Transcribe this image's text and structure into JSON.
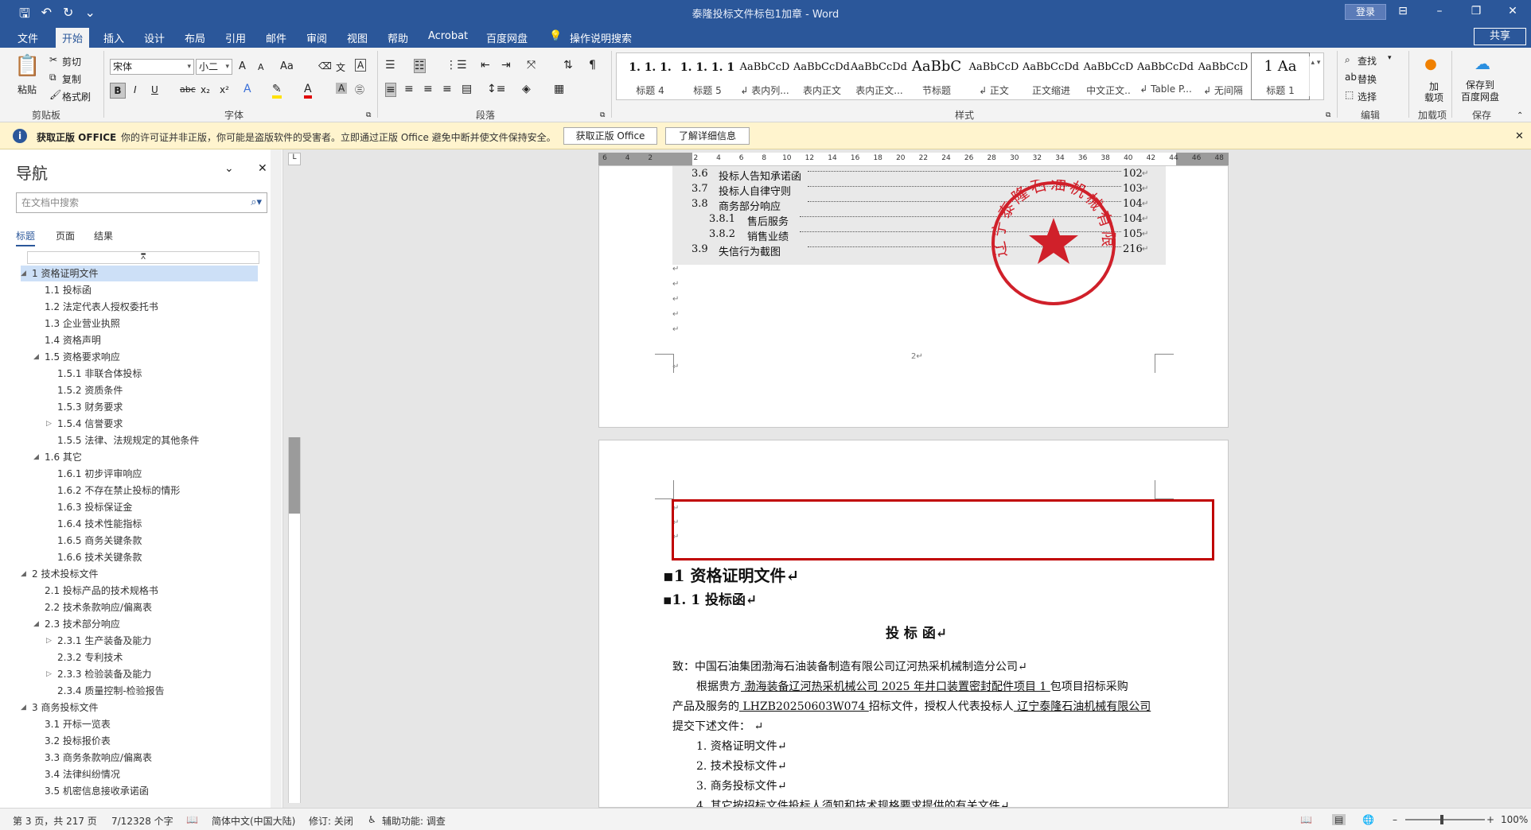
{
  "window": {
    "title": "泰隆投标文件标包1加章 - Word",
    "signin": "登录"
  },
  "qat": {
    "save": "🖫",
    "undo": "↶",
    "redo": "↻",
    "customize": "⌄"
  },
  "tabs": [
    {
      "label": "文件"
    },
    {
      "label": "开始"
    },
    {
      "label": "插入"
    },
    {
      "label": "设计"
    },
    {
      "label": "布局"
    },
    {
      "label": "引用"
    },
    {
      "label": "邮件"
    },
    {
      "label": "审阅"
    },
    {
      "label": "视图"
    },
    {
      "label": "帮助"
    },
    {
      "label": "Acrobat"
    },
    {
      "label": "百度网盘"
    },
    {
      "label": "操作说明搜索"
    }
  ],
  "share": "共享",
  "ribbon": {
    "clipboard": {
      "paste": "粘贴",
      "cut": "剪切",
      "copy": "复制",
      "format_painter": "格式刷",
      "group": "剪贴板"
    },
    "font": {
      "name": "宋体",
      "size": "小二",
      "group": "字体",
      "bold": "B",
      "italic": "I",
      "underline": "U",
      "strike": "abc",
      "sub": "x₂",
      "sup": "x²",
      "grow": "A",
      "shrink": "A",
      "case": "Aa"
    },
    "paragraph": {
      "group": "段落"
    },
    "styles": {
      "group": "样式",
      "items": [
        {
          "preview": "1. 1. 1.",
          "name": "标题 4"
        },
        {
          "preview": "1. 1. 1. 1",
          "name": "标题 5"
        },
        {
          "preview": "AaBbCcD",
          "name": "↲ 表内列..."
        },
        {
          "preview": "AaBbCcDdI",
          "name": "表内正文"
        },
        {
          "preview": "AaBbCcDdI",
          "name": "表内正文..."
        },
        {
          "preview": "AaBbC",
          "name": "节标题"
        },
        {
          "preview": "AaBbCcD",
          "name": "↲ 正文"
        },
        {
          "preview": "AaBbCcDdI",
          "name": "正文缩进"
        },
        {
          "preview": "AaBbCcD",
          "name": "中文正文.."
        },
        {
          "preview": "AaBbCcDdI",
          "name": "↲ Table P..."
        },
        {
          "preview": "AaBbCcD",
          "name": "↲ 无间隔"
        },
        {
          "preview": "1  Aa",
          "name": "标题 1"
        }
      ]
    },
    "editing": {
      "find": "查找",
      "replace": "替换",
      "select": "选择",
      "group": "编辑"
    },
    "addins": {
      "label": "加载项",
      "button": "加\n载项"
    },
    "save": {
      "label": "保存到\n百度网盘",
      "group": "保存"
    }
  },
  "message_bar": {
    "title": "获取正版 OFFICE",
    "text": "你的许可证并非正版，你可能是盗版软件的受害者。立即通过正版 Office 避免中断并使文件保持安全。",
    "btn1": "获取正版 Office",
    "btn2": "了解详细信息"
  },
  "nav": {
    "title": "导航",
    "search_placeholder": "在文档中搜索",
    "tabs": [
      "标题",
      "页面",
      "结果"
    ],
    "outline": [
      {
        "t": "1 资格证明文件",
        "lv": 0,
        "ex": "◢",
        "sel": true
      },
      {
        "t": "1.1 投标函",
        "lv": 1
      },
      {
        "t": "1.2 法定代表人授权委托书",
        "lv": 1
      },
      {
        "t": "1.3 企业营业执照",
        "lv": 1
      },
      {
        "t": "1.4 资格声明",
        "lv": 1
      },
      {
        "t": "1.5 资格要求响应",
        "lv": 1,
        "ex": "◢"
      },
      {
        "t": "1.5.1 非联合体投标",
        "lv": 2
      },
      {
        "t": "1.5.2 资质条件",
        "lv": 2
      },
      {
        "t": "1.5.3 财务要求",
        "lv": 2
      },
      {
        "t": "1.5.4 信誉要求",
        "lv": 2,
        "ex": "▷"
      },
      {
        "t": "1.5.5 法律、法规规定的其他条件",
        "lv": 2
      },
      {
        "t": "1.6 其它",
        "lv": 1,
        "ex": "◢"
      },
      {
        "t": "1.6.1 初步评审响应",
        "lv": 2
      },
      {
        "t": "1.6.2 不存在禁止投标的情形",
        "lv": 2
      },
      {
        "t": "1.6.3 投标保证金",
        "lv": 2
      },
      {
        "t": "1.6.4 技术性能指标",
        "lv": 2
      },
      {
        "t": "1.6.5 商务关键条款",
        "lv": 2
      },
      {
        "t": "1.6.6 技术关键条款",
        "lv": 2
      },
      {
        "t": "2 技术投标文件",
        "lv": 0,
        "ex": "◢"
      },
      {
        "t": "2.1 投标产品的技术规格书",
        "lv": 1
      },
      {
        "t": "2.2 技术条款响应/偏离表",
        "lv": 1
      },
      {
        "t": "2.3 技术部分响应",
        "lv": 1,
        "ex": "◢"
      },
      {
        "t": "2.3.1 生产装备及能力",
        "lv": 2,
        "ex": "▷"
      },
      {
        "t": "2.3.2 专利技术",
        "lv": 2
      },
      {
        "t": "2.3.3 检验装备及能力",
        "lv": 2,
        "ex": "▷"
      },
      {
        "t": "2.3.4 质量控制-检验报告",
        "lv": 2
      },
      {
        "t": "3 商务投标文件",
        "lv": 0,
        "ex": "◢"
      },
      {
        "t": "3.1 开标一览表",
        "lv": 1
      },
      {
        "t": "3.2 投标报价表",
        "lv": 1
      },
      {
        "t": "3.3 商务条款响应/偏离表",
        "lv": 1
      },
      {
        "t": "3.4 法律纠纷情况",
        "lv": 1
      },
      {
        "t": "3.5 机密信息接收承诺函",
        "lv": 1
      }
    ]
  },
  "ruler_ticks": [
    "6",
    "4",
    "2",
    "",
    "2",
    "4",
    "6",
    "8",
    "10",
    "12",
    "14",
    "16",
    "18",
    "20",
    "22",
    "24",
    "26",
    "28",
    "30",
    "32",
    "34",
    "36",
    "38",
    "40",
    "42",
    "44",
    "46",
    "48"
  ],
  "page1": {
    "toc": [
      {
        "num": "3.6",
        "text": "投标人告知承诺函",
        "page": "102",
        "indent": 0
      },
      {
        "num": "3.7",
        "text": "投标人自律守则",
        "page": "103",
        "indent": 0
      },
      {
        "num": "3.8",
        "text": "商务部分响应",
        "page": "104",
        "indent": 0
      },
      {
        "num": "3.8.1",
        "text": "售后服务",
        "page": "104",
        "indent": 1
      },
      {
        "num": "3.8.2",
        "text": "销售业绩",
        "page": "105",
        "indent": 1
      },
      {
        "num": "3.9",
        "text": "失信行为截图",
        "page": "216",
        "indent": 0
      }
    ],
    "page_number": "2↵",
    "stamp_text": "辽宁泰隆石油机械有限公司"
  },
  "page2": {
    "h1": "1  资格证明文件↵",
    "h2": "1. 1 投标函↵",
    "title": "投 标 函↵",
    "to": "致：中国石油集团渤海石油装备制造有限公司辽河热采机械制造分公司↵",
    "p1a": "根据贵方",
    "p1b": " 渤海装备辽河热采机械公司 2025 年井口装置密封配件项目 1 ",
    "p1c": "包项目招标采购",
    "p2a": "产品及服务的",
    "p2b": " LHZB20250603W074 ",
    "p2c": "招标文件，授权人代表投标人",
    "p2d": " 辽宁泰隆石油机械有限公司 ",
    "p3": "提交下述文件：  ↵",
    "list": [
      "1.   资格证明文件↵",
      "2.   技术投标文件↵",
      "3.   商务投标文件↵",
      "4.   其它按招标文件投标人须知和技术规格要求提供的有关文件↵"
    ]
  },
  "status": {
    "page": "第 3 页，共 217 页",
    "words": "7/12328 个字",
    "lang": "简体中文(中国大陆)",
    "track": "修订: 关闭",
    "access": "辅助功能: 调查",
    "zoom": "100%"
  },
  "colors": {
    "accent": "#2b579a",
    "stamp": "#d0202a",
    "highlight": "#c00000"
  }
}
